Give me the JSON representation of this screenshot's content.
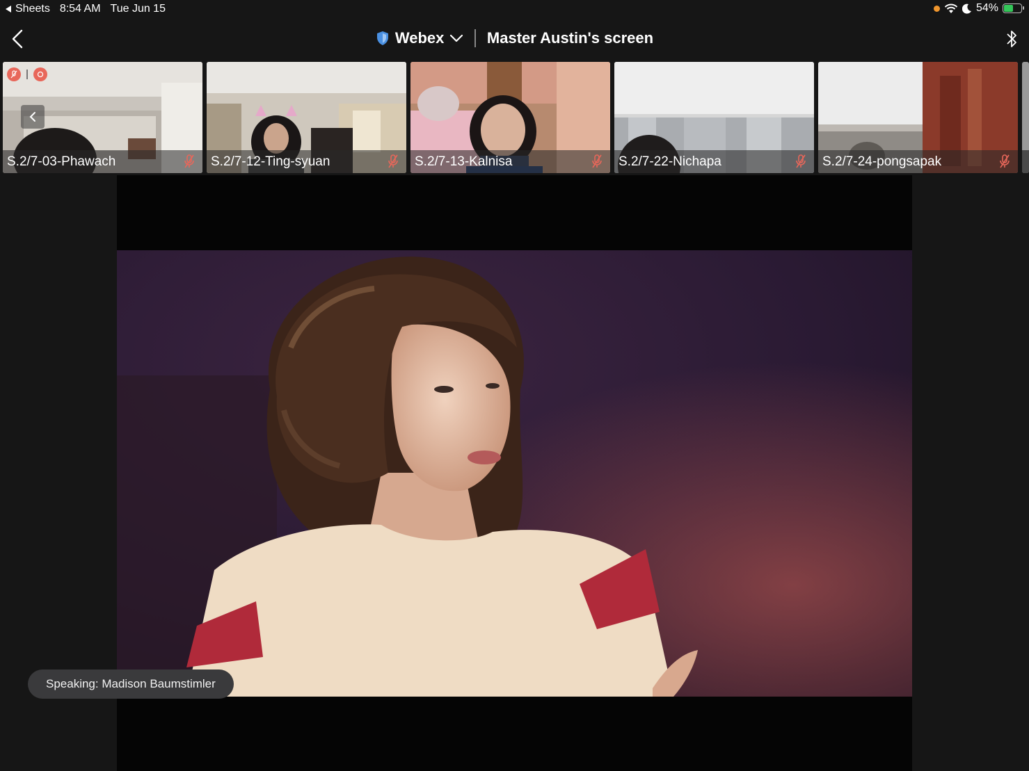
{
  "status_bar": {
    "back_app": "Sheets",
    "time": "8:54 AM",
    "date": "Tue Jun 15",
    "battery": "54%",
    "battery_level": 0.54,
    "icons": [
      "orange-dot",
      "wifi-icon",
      "moon-icon",
      "battery-icon"
    ]
  },
  "header": {
    "app_name": "Webex",
    "screen_title": "Master Austin's screen",
    "icons": [
      "back-chevron-icon",
      "shield-icon",
      "chevron-down-icon",
      "bluetooth-icon"
    ]
  },
  "participants": [
    {
      "name": "S.2/7-03-Phawach",
      "muted": true
    },
    {
      "name": "S.2/7-12-Ting-syuan",
      "muted": true
    },
    {
      "name": "S.2/7-13-Kalnisa",
      "muted": true
    },
    {
      "name": "S.2/7-22-Nichapa",
      "muted": true
    },
    {
      "name": "S.2/7-24-pongsapak",
      "muted": true
    }
  ],
  "speaking": {
    "text": "Speaking: Madison Baumstimler"
  },
  "colors": {
    "background": "#161616",
    "accent_orange": "#f0962d",
    "mute_red": "#e8675a",
    "battery_green": "#34c759"
  }
}
